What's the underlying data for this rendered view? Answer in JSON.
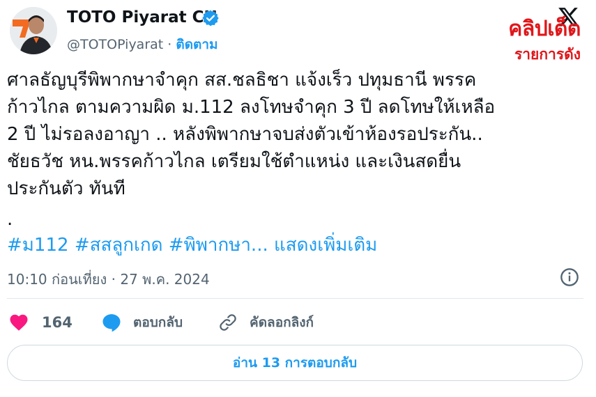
{
  "author": {
    "name": "TOTO Piyarat CH",
    "handle": "@TOTOPiyarat",
    "separator": " · ",
    "follow_label": "ติดตาม"
  },
  "overlay": {
    "title": "คลิปเด็ด",
    "subtitle": "รายการดัง"
  },
  "tweet": {
    "text": "ศาลธัญบุรีพิพากษาจำคุก สส.ชลธิชา แจ้งเร็ว  ปทุมธานี พรรค\nก้าวไกล ตามความผิด ม.112  ลงโทษจำคุก 3 ปี ลดโทษให้เหลือ\n2 ปี ไม่รอลงอาญา   .. หลังพิพากษาจบส่งตัวเข้าห้องรอประกัน..\nชัยธวัช หน.พรรคก้าวไกล เตรียมใช้ตำแหน่ง และเงินสดยื่น\nประกันตัว ทันที",
    "dot": ".",
    "hashtags": "#ม112 #สสลูกเกด #พิพากษา...",
    "show_more": "แสดงเพิ่มเติม",
    "timestamp": "10:10 ก่อนเที่ยง · 27 พ.ค. 2024"
  },
  "actions": {
    "like_count": "164",
    "reply_label": "ตอบกลับ",
    "copy_link_label": "คัดลอกลิงก์"
  },
  "read_replies_label": "อ่าน 13 การตอบกลับ",
  "colors": {
    "accent": "#1d9bf0",
    "like": "#f91880",
    "overlay_red": "#e0161a",
    "muted": "#536471"
  },
  "icons": {
    "verified": "verified-badge-icon",
    "x_logo": "x-logo-icon",
    "info": "info-icon",
    "like": "heart-icon",
    "reply": "reply-bubble-icon",
    "copy_link": "link-icon"
  }
}
